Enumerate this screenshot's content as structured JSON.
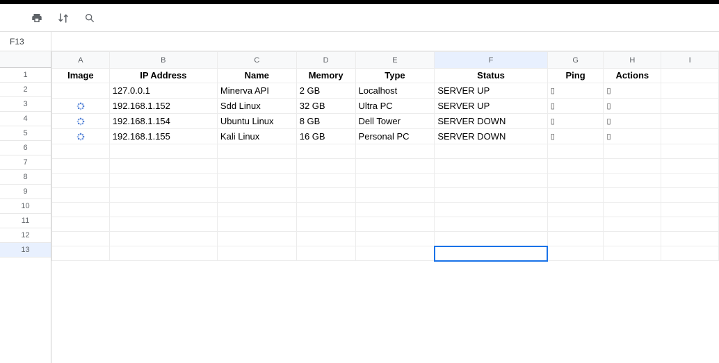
{
  "namebox": {
    "reference": "F13"
  },
  "columns": [
    "A",
    "B",
    "C",
    "D",
    "E",
    "F",
    "G",
    "H",
    "I"
  ],
  "rowCount": 13,
  "selected": {
    "col": "F",
    "row": 13
  },
  "headers": {
    "image": "Image",
    "ip": "IP Address",
    "name": "Name",
    "memory": "Memory",
    "type": "Type",
    "status": "Status",
    "ping": "Ping",
    "actions": "Actions"
  },
  "rows": [
    {
      "image_icon": "",
      "ip": "127.0.0.1",
      "name": "Minerva API",
      "memory": "2 GB",
      "type": "Localhost",
      "status": "SERVER UP",
      "ping": "▯",
      "actions": "▯"
    },
    {
      "image_icon": "spinner",
      "ip": "192.168.1.152",
      "name": "Sdd Linux",
      "memory": "32 GB",
      "type": "Ultra PC",
      "status": "SERVER UP",
      "ping": "▯",
      "actions": "▯"
    },
    {
      "image_icon": "spinner",
      "ip": "192.168.1.154",
      "name": "Ubuntu Linux",
      "memory": "8 GB",
      "type": "Dell Tower",
      "status": "SERVER DOWN",
      "ping": "▯",
      "actions": "▯"
    },
    {
      "image_icon": "spinner",
      "ip": "192.168.1.155",
      "name": "Kali Linux",
      "memory": "16 GB",
      "type": "Personal PC",
      "status": "SERVER DOWN",
      "ping": "▯",
      "actions": "▯"
    }
  ],
  "icons": {
    "print": "print-icon",
    "sort": "sort-icon",
    "search": "search-icon"
  }
}
